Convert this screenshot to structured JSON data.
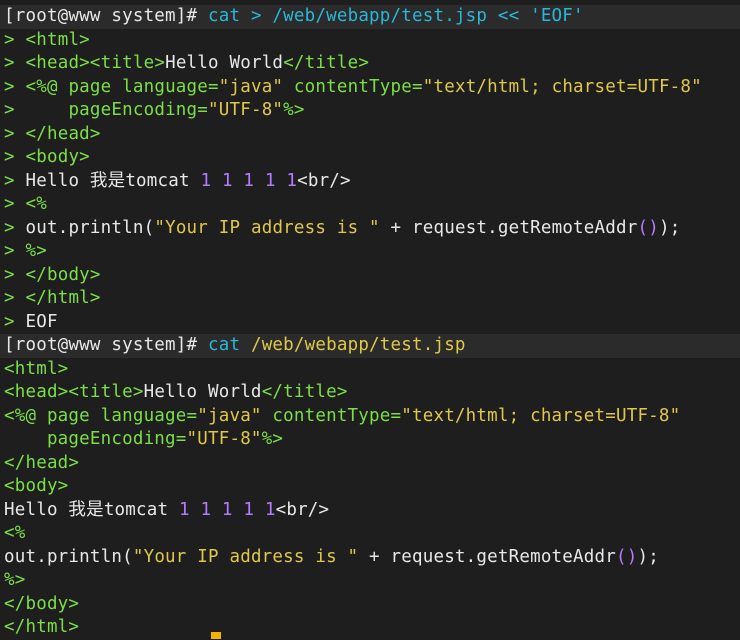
{
  "terminal": {
    "prompt": "[root@www system]#",
    "cmd1": {
      "cat": "cat",
      "rest": " > /web/webapp/test.jsp << 'EOF'"
    },
    "heredoc": {
      "gt": ">",
      "l1": "<html>",
      "l2a": "<head>",
      "l2b": "<title>",
      "l2c": "Hello World",
      "l2d": "</title>",
      "l3a": "<%@ page language=",
      "l3b": "\"java\"",
      "l3c": " contentType=",
      "l3d": "\"text/html; charset=UTF-8\"",
      "l4a": "    pageEncoding=",
      "l4b": "\"UTF-8\"",
      "l4c": "%>",
      "l5": "</head",
      "l5b": ">",
      "l6": "<body>",
      "l7a": "Hello 我是tomcat ",
      "l7b": "1 1 1 1 1",
      "l7c": "<br/>",
      "l8": "<%",
      "l9a": "out.println(",
      "l9b": "\"Your IP address is \"",
      "l9c": " + request.getRemoteAddr",
      "l9d": "()",
      "l9e": ");",
      "l10": "%>",
      "l11": "</body>",
      "l12": "</html>",
      "l13": "EOF"
    },
    "cmd2": {
      "cat": "cat",
      "rest": " /web/webapp/test.jsp"
    },
    "output": {
      "o1": "<html>",
      "o2a": "<head>",
      "o2b": "<title>",
      "o2c": "Hello World",
      "o2d": "</title>",
      "o3a": "<%@ page language=",
      "o3b": "\"java\"",
      "o3c": " contentType=",
      "o3d": "\"text/html; charset=UTF-8\"",
      "o4a": "    pageEncoding=",
      "o4b": "\"UTF-8\"",
      "o4c": "%>",
      "o5": "</head>",
      "o6": "<body>",
      "o7a": "Hello 我是tomcat ",
      "o7b": "1 1 1 1 1",
      "o7c": "<br/>",
      "o8": "<%",
      "o9a": "out.println(",
      "o9b": "\"Your IP address is \"",
      "o9c": " + request.getRemoteAddr",
      "o9d": "()",
      "o9e": ");",
      "o10": "%>",
      "o11": "</body>",
      "o12": "</html>"
    },
    "colors": {
      "background": "#1e1e1e",
      "tag": "#7cdf47",
      "string": "#e0c84a",
      "number": "#b57bff",
      "command": "#2ab7d8",
      "cursor": "#f0b400"
    }
  }
}
